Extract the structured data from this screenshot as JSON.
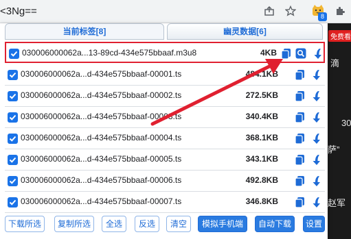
{
  "browser": {
    "address_text": "<3Ng==",
    "extension_badge": "8"
  },
  "background_page": {
    "badge": "免费看",
    "text_1": "滴",
    "text_2": "30",
    "text_3": "萨”",
    "text_4": "赵军"
  },
  "popup": {
    "tabs": [
      {
        "label": "当前标签[8]"
      },
      {
        "label": "幽灵数据[6]"
      }
    ],
    "rows": [
      {
        "name": "030006000062a...13-89cd-434e575bbaaf.m3u8",
        "size": "4KB",
        "checked": true,
        "has_search": true
      },
      {
        "name": "030006000062a...d-434e575bbaaf-00001.ts",
        "size": "484.1KB",
        "checked": true,
        "has_search": false
      },
      {
        "name": "030006000062a...d-434e575bbaaf-00002.ts",
        "size": "272.5KB",
        "checked": true,
        "has_search": false
      },
      {
        "name": "030006000062a...d-434e575bbaaf-00003.ts",
        "size": "340.4KB",
        "checked": true,
        "has_search": false
      },
      {
        "name": "030006000062a...d-434e575bbaaf-00004.ts",
        "size": "368.1KB",
        "checked": true,
        "has_search": false
      },
      {
        "name": "030006000062a...d-434e575bbaaf-00005.ts",
        "size": "343.1KB",
        "checked": true,
        "has_search": false
      },
      {
        "name": "030006000062a...d-434e575bbaaf-00006.ts",
        "size": "492.8KB",
        "checked": true,
        "has_search": false
      },
      {
        "name": "030006000062a...d-434e575bbaaf-00007.ts",
        "size": "346.8KB",
        "checked": true,
        "has_search": false
      }
    ],
    "buttons": {
      "download_selected": "下载所选",
      "copy_selected": "复制所选",
      "select_all": "全选",
      "invert": "反选",
      "clear": "清空",
      "mobile": "模拟手机端",
      "auto_download": "自动下载",
      "settings": "设置"
    }
  },
  "colors": {
    "accent": "#1a73e8",
    "highlight_border": "#e02030",
    "arrow": "#e02030"
  }
}
